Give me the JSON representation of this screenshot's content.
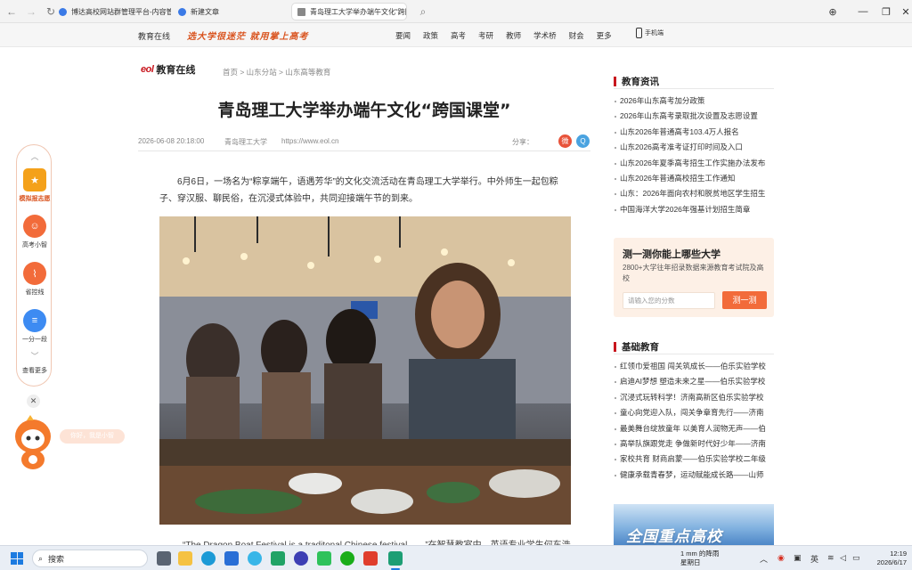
{
  "browser": {
    "tabs": [
      {
        "title": "博达高校网站群管理平台-内容管理",
        "active": false
      },
      {
        "title": "新建文章",
        "active": false
      },
      {
        "title": "青岛理工大学举办端午文化“跨国课",
        "active": true
      }
    ]
  },
  "site": {
    "brand": "教育在线",
    "slogan": "选大学很迷茫 就用掌上高考",
    "menu": [
      "要闻",
      "政策",
      "高考",
      "考研",
      "教师",
      "学术桥",
      "财会",
      "更多"
    ],
    "mobile": "手机端"
  },
  "logo": {
    "mark": "eol",
    "name": "教育在线"
  },
  "breadcrumb": "首页 > 山东分站 > 山东高等教育",
  "article": {
    "title": "青岛理工大学举办端午文化“跨国课堂”",
    "date": "2026-06-08 20:18:00",
    "source": "青岛理工大学",
    "url": "https://www.eol.cn",
    "share_label": "分享：",
    "lead": "6月6日，一场名为“粽享端午，语遇芳华”的文化交流活动在青岛理工大学举行。中外师生一起包粽子、穿汉服、聊民俗，在沉浸式体验中，共同迎接端午节的到来。",
    "caption": "“The Dragon Boat Festival is a traditonal Chinese festival……”在智慧教室中，英语专业学生何东浩"
  },
  "sidebar": {
    "news_title": "教育资讯",
    "news": [
      "2026年山东高考加分政策",
      "2026年山东高考录取批次设置及志愿设置",
      "山东2026年普通高考103.4万人报名",
      "山东2026高考准考证打印时间及入口",
      "山东2026年夏季高考招生工作实施办法发布",
      "山东2026年普通高校招生工作通知",
      "山东：2026年面向农村和脱贫地区学生招生",
      "中国海洋大学2026年强基计划招生简章"
    ],
    "quiz": {
      "title": "测一测你能上哪些大学",
      "desc": "2800+大学往年招录数据来源教育考试院及高校",
      "placeholder": "请输入您的分数",
      "button": "测一测"
    },
    "basic_title": "基础教育",
    "basic": [
      "红领巾爱祖国 闯关筑成长——伯乐实验学校",
      "启迪AI梦想 塑造未来之星——伯乐实验学校",
      "沉浸式玩转科学！济南高新区伯乐实验学校",
      "童心向党迎入队，闯关争章育先行——济南",
      "最美舞台绽放童年 以美育人润物无声——伯",
      "高举队旗跟党走 争做新时代好少年——济南",
      "家校共育 财商启蒙——伯乐实验学校二年级",
      "健康承载青春梦，运动赋能成长路——山师"
    ],
    "banner": "全国重点高校"
  },
  "float_widget": {
    "items": [
      {
        "label": "模拟报志愿",
        "icon": "volunteer-icon",
        "color": "#f4a11a"
      },
      {
        "label": "高考小智",
        "icon": "robot-icon",
        "color": "#f26b3a"
      },
      {
        "label": "省控线",
        "icon": "chart-icon",
        "color": "#f26b3a"
      },
      {
        "label": "一分一段",
        "icon": "document-icon",
        "color": "#3d8bf2"
      }
    ],
    "more": "查看更多",
    "bubble": "你好，我是小智"
  },
  "taskbar": {
    "search": "搜索",
    "weather_line1": "1 mm 的降雨",
    "weather_line2": "星期日",
    "ime": "英",
    "time": "12:19",
    "date": "2026/6/17"
  }
}
